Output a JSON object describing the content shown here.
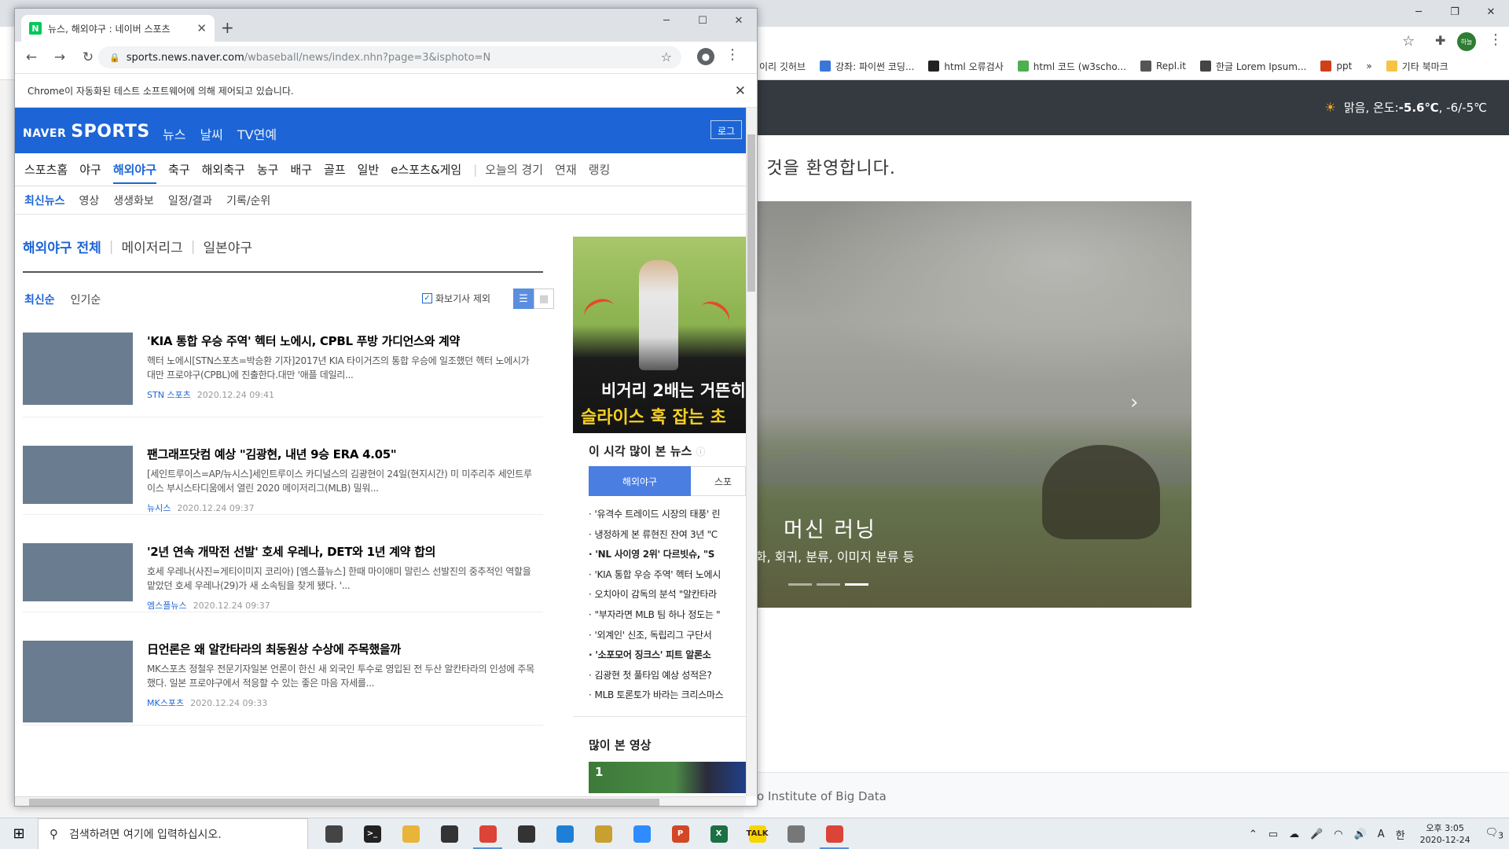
{
  "background_browser": {
    "bookmarks": [
      {
        "label": "이리 깃허브",
        "color": "#333"
      },
      {
        "label": "강좌: 파이썬 코딩...",
        "color": "#3a76d8"
      },
      {
        "label": "html 오류검사",
        "color": "#222"
      },
      {
        "label": "html 코드 (w3scho...",
        "color": "#4caf50"
      },
      {
        "label": "Repl.it",
        "color": "#555"
      },
      {
        "label": "한글 Lorem Ipsum...",
        "color": "#444"
      },
      {
        "label": "ppt",
        "color": "#d0401a"
      }
    ],
    "bookmarks_more": "»",
    "other_bookmarks": "기타 북마크",
    "profile_label": "하늘",
    "weather": {
      "prefix": "맑음, 온도: ",
      "temp": "-5.6℃",
      "range": ", -6/-5℃"
    },
    "welcome": "신 것을 환영합니다.",
    "hero": {
      "title": "머신 러닝",
      "subtitle": "진화, 회귀, 분류, 이미지 분류 등",
      "next_icon": "chevron-right-icon"
    },
    "footer": "seo Institute of Big Data"
  },
  "window": {
    "tab_title": "뉴스, 해외야구 : 네이버 스포츠",
    "tab_favicon": "N",
    "url_host": "sports.news.naver.com",
    "url_path": "/wbaseball/news/index.nhn?page=3&isphoto=N",
    "automation_notice": "Chrome이 자동화된 테스트 소프트웨어에 의해 제어되고 있습니다."
  },
  "naver": {
    "logo_small": "NAVER",
    "logo_big": "SPORTS",
    "top_menu": [
      "뉴스",
      "날씨",
      "TV연예"
    ],
    "login": "로그",
    "main_menu": [
      "스포츠홈",
      "야구",
      "해외야구",
      "축구",
      "해외축구",
      "농구",
      "배구",
      "골프",
      "일반",
      "e스포츠&게임"
    ],
    "main_menu_light": [
      "오늘의 경기",
      "연재",
      "랭킹"
    ],
    "sub_menu": [
      "최신뉴스",
      "영상",
      "생생화보",
      "일정/결과",
      "기록/순위"
    ],
    "categories": [
      "해외야구 전체",
      "메이저리그",
      "일본야구"
    ],
    "sort": [
      "최신순",
      "인기순"
    ],
    "photo_exclude": "화보기사 제외",
    "articles": [
      {
        "title": "'KIA 통합 우승 주역' 헥터 노에시, CPBL 푸방 가디언스와 계약",
        "summary": "헥터 노에시[STN스포츠=박승환 기자]2017년 KIA 타이거즈의 통합 우승에 일조했던 헥터 노에시가 대만 프로야구(CPBL)에 진출한다.대만 '애플 데일리...",
        "source": "STN 스포츠",
        "date": "2020.12.24 09:41"
      },
      {
        "title": "팬그래프닷컴 예상 \"김광현, 내년 9승 ERA 4.05\"",
        "summary": "[세인트루이스=AP/뉴시스]세인트루이스 카디널스의 김광현이 24일(현지시간) 미 미주리주 세인트루이스 부시스타디움에서 열린 2020 메이저리그(MLB) 밀워...",
        "source": "뉴시스",
        "date": "2020.12.24 09:37"
      },
      {
        "title": "'2년 연속 개막전 선발' 호세 우레나, DET와 1년 계약 합의",
        "summary": "호세 우레나(사진=게티이미지 코리아) [엠스플뉴스] 한때 마이애미 말린스 선발진의 중추적인 역할을 맡았던 호세 우레나(29)가 새 소속팀을 찾게 됐다. '...",
        "source": "엠스플뉴스",
        "date": "2020.12.24 09:37"
      },
      {
        "title": "日언론은 왜 알칸타라의 최동원상 수상에 주목했을까",
        "summary": "MK스포츠 정철우 전문기자일본 언론이 한신 새 외국인 투수로 영입된 전 두산 알칸타라의 인성에 주목했다. 일본 프로야구에서 적응할 수 있는 좋은 마음 자세를...",
        "source": "MK스포츠",
        "date": "2020.12.24 09:33"
      }
    ],
    "ad": {
      "line1": "비거리 2배는 거뜬히",
      "line2": "슬라이스 훅 잡는 초"
    },
    "popular_title": "이 시각 많이 본 뉴스",
    "popular_tabs": [
      "해외야구",
      "스포"
    ],
    "popular": [
      {
        "text": "'유격수 트레이드 시장의 태풍' 린",
        "bold": false
      },
      {
        "text": "냉정하게 본 류현진 잔여 3년 \"C",
        "bold": false
      },
      {
        "text": "'NL 사이영 2위' 다르빗슈, \"S",
        "bold": true
      },
      {
        "text": "'KIA 통합 우승 주역' 헥터 노에시",
        "bold": false
      },
      {
        "text": "오치아이 감독의 분석 \"알칸타라",
        "bold": false
      },
      {
        "text": "\"부자라면 MLB 팀 하나 정도는 \"",
        "bold": false
      },
      {
        "text": "'외계인' 신조, 독립리그 구단서 ",
        "bold": false
      },
      {
        "text": "'소포모어 징크스' 피트 알론소",
        "bold": true
      },
      {
        "text": "김광현 첫 풀타임 예상 성적은? ",
        "bold": false
      },
      {
        "text": "MLB 토론토가 바라는 크리스마스",
        "bold": false
      }
    ],
    "video_title": "많이 본 영상",
    "video_rank": "1"
  },
  "taskbar": {
    "search_placeholder": "검색하려면 여기에 입력하십시오.",
    "apps": [
      {
        "name": "task-view-icon",
        "label": "",
        "color": "#444"
      },
      {
        "name": "terminal-icon",
        "label": ">_",
        "color": "#222"
      },
      {
        "name": "file-explorer-icon",
        "label": "",
        "color": "#e8b43a"
      },
      {
        "name": "terminal-icon",
        "label": "",
        "color": "#333"
      },
      {
        "name": "chrome-icon",
        "label": "",
        "color": "#db4437"
      },
      {
        "name": "app-icon",
        "label": "",
        "color": "#333"
      },
      {
        "name": "vscode-icon",
        "label": "",
        "color": "#1e7fd6"
      },
      {
        "name": "paint-icon",
        "label": "",
        "color": "#c8a030"
      },
      {
        "name": "zoom-icon",
        "label": "",
        "color": "#2d8cff"
      },
      {
        "name": "powerpoint-icon",
        "label": "P",
        "color": "#d24726"
      },
      {
        "name": "excel-icon",
        "label": "X",
        "color": "#1d7044"
      },
      {
        "name": "kakaotalk-icon",
        "label": "TALK",
        "color": "#f7d600"
      },
      {
        "name": "app-icon",
        "label": "",
        "color": "#777"
      },
      {
        "name": "chrome-icon",
        "label": "",
        "color": "#db4437"
      }
    ],
    "ime_a": "A",
    "ime_han": "한",
    "time": "오후 3:05",
    "date": "2020-12-24",
    "notifications": "3"
  }
}
